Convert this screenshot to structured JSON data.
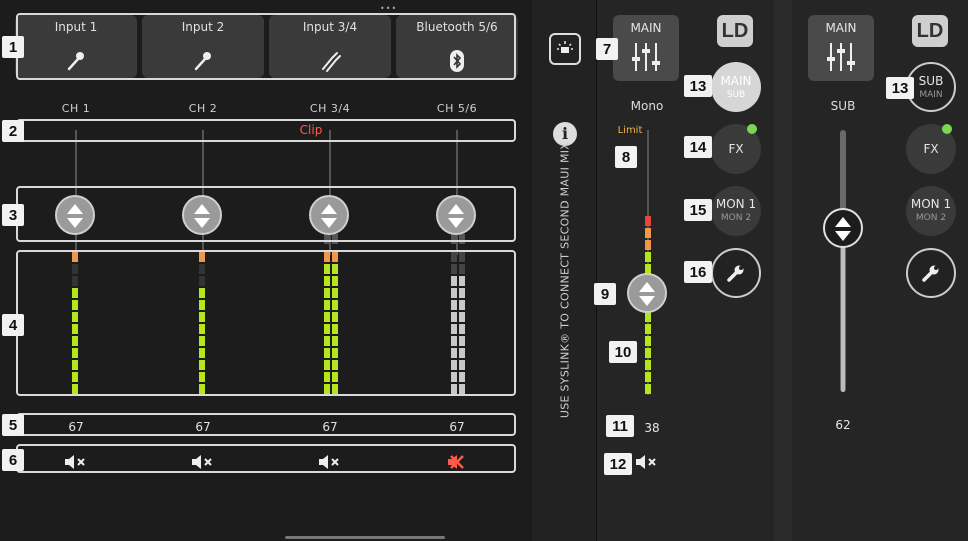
{
  "inputs": [
    {
      "label": "Input 1",
      "icon": "microphone-icon"
    },
    {
      "label": "Input 2",
      "icon": "microphone-icon"
    },
    {
      "label": "Input 3/4",
      "icon": "guitar-cable-icon"
    },
    {
      "label": "Bluetooth 5/6",
      "icon": "bluetooth-icon"
    }
  ],
  "channels": [
    {
      "label": "CH 1",
      "value": "67"
    },
    {
      "label": "CH 2",
      "value": "67"
    },
    {
      "label": "CH 3/4",
      "value": "67"
    },
    {
      "label": "CH 5/6",
      "value": "67"
    }
  ],
  "clip_label": "Clip",
  "syslink_text": "USE SYSLINK® TO CONNECT SECOND MAUI MIX",
  "info_glyph": "i",
  "main": {
    "title": "MAIN",
    "mode": "Mono",
    "limit_label": "Limit",
    "value": "38",
    "logo": "LD",
    "buttons": [
      {
        "label": "MAIN",
        "sub": "SUB"
      },
      {
        "label": "FX",
        "sub": ""
      },
      {
        "label": "MON 1",
        "sub": "MON 2"
      }
    ]
  },
  "sub": {
    "title": "MAIN",
    "mode": "SUB",
    "value": "62",
    "logo": "LD",
    "buttons": [
      {
        "label": "SUB",
        "sub": "MAIN"
      },
      {
        "label": "FX",
        "sub": ""
      },
      {
        "label": "MON 1",
        "sub": "MON 2"
      }
    ]
  },
  "callouts": [
    "1",
    "2",
    "3",
    "4",
    "5",
    "6",
    "7",
    "8",
    "9",
    "10",
    "11",
    "12",
    "13",
    "14",
    "15",
    "16",
    "13"
  ],
  "colors": {
    "meter_green": "#b5e61d",
    "meter_orange": "#f0974a",
    "meter_red": "#e8453c",
    "meter_gray": "#c8c8c8",
    "fx_active": "#7bd651",
    "clip": "#ff5b4a",
    "limit": "#f0b24a"
  }
}
